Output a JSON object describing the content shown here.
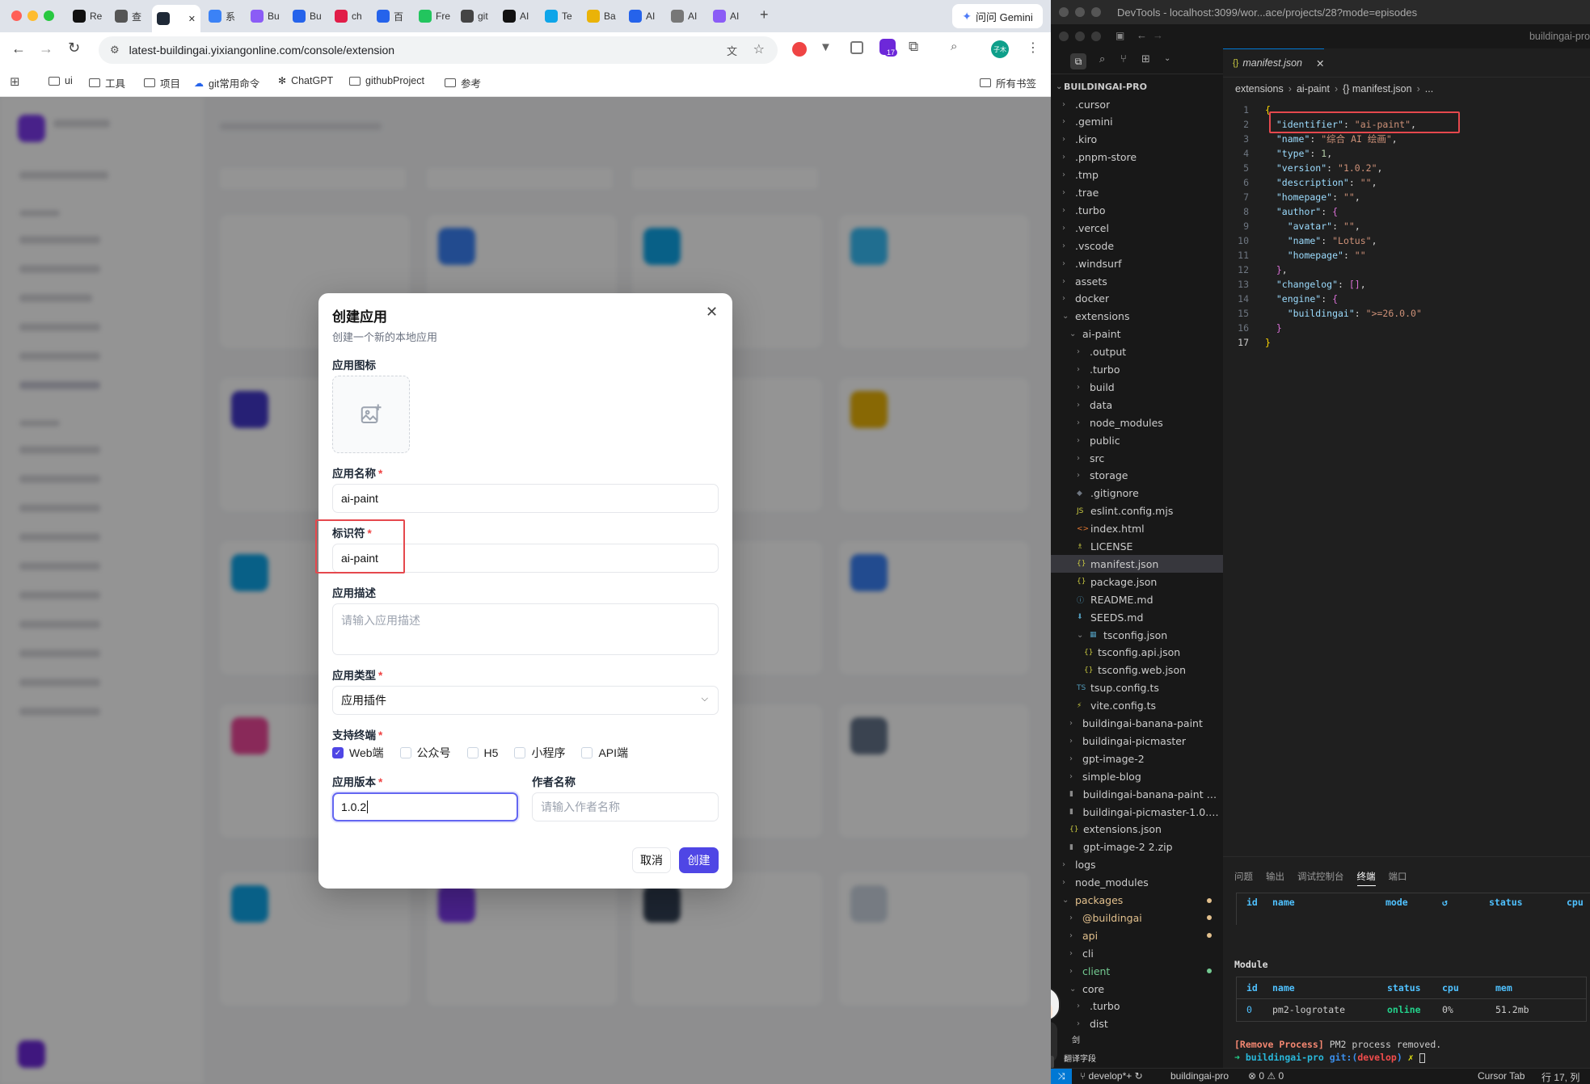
{
  "browser": {
    "tabs": [
      {
        "label": "Re",
        "color": "#111111"
      },
      {
        "label": "查",
        "color": "#555555"
      },
      {
        "label": "",
        "color": "#1f2937"
      },
      {
        "label": "系",
        "color": "#3b82f6"
      },
      {
        "label": "Bu",
        "color": "#8b5cf6"
      },
      {
        "label": "Bu",
        "color": "#2563eb"
      },
      {
        "label": "ch",
        "color": "#e11d48"
      },
      {
        "label": "百",
        "color": "#2563eb"
      },
      {
        "label": "Fre",
        "color": "#22c55e"
      },
      {
        "label": "git",
        "color": "#444444"
      },
      {
        "label": "AI",
        "color": "#111111"
      },
      {
        "label": "Te",
        "color": "#0ea5e9"
      },
      {
        "label": "Ba",
        "color": "#eab308"
      },
      {
        "label": "AI",
        "color": "#2563eb"
      },
      {
        "label": "AI",
        "color": "#777777"
      },
      {
        "label": "AI",
        "color": "#8b5cf6"
      }
    ],
    "new_tab": "+",
    "gemini_label": "问问 Gemini",
    "url": "latest-buildingai.yixiangonline.com/console/extension",
    "extension_badge": "17",
    "profile_label": "子木",
    "bookmarks": [
      "ui",
      "工具",
      "项目",
      "git常用命令",
      "ChatGPT",
      "githubProject",
      "参考"
    ],
    "all_bookmarks": "所有书签"
  },
  "modal": {
    "title": "创建应用",
    "subtitle": "创建一个新的本地应用",
    "icon_label": "应用图标",
    "name_label": "应用名称",
    "name_value": "ai-paint",
    "identifier_label": "标识符",
    "identifier_value": "ai-paint",
    "desc_label": "应用描述",
    "desc_placeholder": "请输入应用描述",
    "type_label": "应用类型",
    "type_value": "应用插件",
    "terminal_label": "支持终端",
    "terminals": [
      {
        "label": "Web端",
        "checked": true
      },
      {
        "label": "公众号",
        "checked": false
      },
      {
        "label": "H5",
        "checked": false
      },
      {
        "label": "小程序",
        "checked": false
      },
      {
        "label": "API端",
        "checked": false
      }
    ],
    "version_label": "应用版本",
    "version_value": "1.0.2",
    "author_label": "作者名称",
    "author_placeholder": "请输入作者名称",
    "cancel": "取消",
    "create": "创建",
    "required_mark": "*",
    "accent": "#4f46e5"
  },
  "devtools": {
    "title": "DevTools - localhost:3099/wor...ace/projects/28?mode=episodes",
    "window_title": "buildingai-pro",
    "tab_file": "manifest.json",
    "tab_icon": "{}",
    "breadcrumb": [
      "extensions",
      "ai-paint",
      "{} manifest.json",
      "..."
    ],
    "root": "BUILDINGAI-PRO",
    "tree": [
      {
        "name": ".cursor",
        "lvl": 0,
        "kind": "dir"
      },
      {
        "name": ".gemini",
        "lvl": 0,
        "kind": "dir"
      },
      {
        "name": ".kiro",
        "lvl": 0,
        "kind": "dir"
      },
      {
        "name": ".pnpm-store",
        "lvl": 0,
        "kind": "dir"
      },
      {
        "name": ".tmp",
        "lvl": 0,
        "kind": "dir"
      },
      {
        "name": ".trae",
        "lvl": 0,
        "kind": "dir"
      },
      {
        "name": ".turbo",
        "lvl": 0,
        "kind": "dir"
      },
      {
        "name": ".vercel",
        "lvl": 0,
        "kind": "dir"
      },
      {
        "name": ".vscode",
        "lvl": 0,
        "kind": "dir"
      },
      {
        "name": ".windsurf",
        "lvl": 0,
        "kind": "dir"
      },
      {
        "name": "assets",
        "lvl": 0,
        "kind": "dir"
      },
      {
        "name": "docker",
        "lvl": 0,
        "kind": "dir"
      },
      {
        "name": "extensions",
        "lvl": 0,
        "kind": "open"
      },
      {
        "name": "ai-paint",
        "lvl": 1,
        "kind": "open"
      },
      {
        "name": ".output",
        "lvl": 2,
        "kind": "dir"
      },
      {
        "name": ".turbo",
        "lvl": 2,
        "kind": "dir"
      },
      {
        "name": "build",
        "lvl": 2,
        "kind": "dir"
      },
      {
        "name": "data",
        "lvl": 2,
        "kind": "dir"
      },
      {
        "name": "node_modules",
        "lvl": 2,
        "kind": "dir"
      },
      {
        "name": "public",
        "lvl": 2,
        "kind": "dir"
      },
      {
        "name": "src",
        "lvl": 2,
        "kind": "dir"
      },
      {
        "name": "storage",
        "lvl": 2,
        "kind": "dir"
      },
      {
        "name": ".gitignore",
        "lvl": 2,
        "kind": "file",
        "icon": "◆",
        "icolor": "#6e7681"
      },
      {
        "name": "eslint.config.mjs",
        "lvl": 2,
        "kind": "file",
        "icon": "JS",
        "icolor": "#cbcb41"
      },
      {
        "name": "index.html",
        "lvl": 2,
        "kind": "file",
        "icon": "<>",
        "icolor": "#e37933"
      },
      {
        "name": "LICENSE",
        "lvl": 2,
        "kind": "file",
        "icon": "♗",
        "icolor": "#cbcb41"
      },
      {
        "name": "manifest.json",
        "lvl": 2,
        "kind": "file",
        "icon": "{}",
        "icolor": "#cbcb41",
        "selected": true
      },
      {
        "name": "package.json",
        "lvl": 2,
        "kind": "file",
        "icon": "{}",
        "icolor": "#cbcb41"
      },
      {
        "name": "README.md",
        "lvl": 2,
        "kind": "file",
        "icon": "ⓘ",
        "icolor": "#519aba"
      },
      {
        "name": "SEEDS.md",
        "lvl": 2,
        "kind": "file",
        "icon": "⬇",
        "icolor": "#519aba"
      },
      {
        "name": "tsconfig.json",
        "lvl": 2,
        "kind": "open",
        "icon": "▦",
        "icolor": "#519aba"
      },
      {
        "name": "tsconfig.api.json",
        "lvl": 3,
        "kind": "file",
        "icon": "{}",
        "icolor": "#cbcb41"
      },
      {
        "name": "tsconfig.web.json",
        "lvl": 3,
        "kind": "file",
        "icon": "{}",
        "icolor": "#cbcb41"
      },
      {
        "name": "tsup.config.ts",
        "lvl": 2,
        "kind": "file",
        "icon": "TS",
        "icolor": "#519aba"
      },
      {
        "name": "vite.config.ts",
        "lvl": 2,
        "kind": "file",
        "icon": "⚡",
        "icolor": "#cbcb41"
      },
      {
        "name": "buildingai-banana-paint",
        "lvl": 1,
        "kind": "dir"
      },
      {
        "name": "buildingai-picmaster",
        "lvl": 1,
        "kind": "dir"
      },
      {
        "name": "gpt-image-2",
        "lvl": 1,
        "kind": "dir"
      },
      {
        "name": "simple-blog",
        "lvl": 1,
        "kind": "dir"
      },
      {
        "name": "buildingai-banana-paint 2....",
        "lvl": 1,
        "kind": "file",
        "icon": "▮",
        "icolor": "#8a8a8a"
      },
      {
        "name": "buildingai-picmaster-1.0.5....",
        "lvl": 1,
        "kind": "file",
        "icon": "▮",
        "icolor": "#8a8a8a"
      },
      {
        "name": "extensions.json",
        "lvl": 1,
        "kind": "file",
        "icon": "{}",
        "icolor": "#cbcb41"
      },
      {
        "name": "gpt-image-2 2.zip",
        "lvl": 1,
        "kind": "file",
        "icon": "▮",
        "icolor": "#8a8a8a"
      },
      {
        "name": "logs",
        "lvl": 0,
        "kind": "dir"
      },
      {
        "name": "node_modules",
        "lvl": 0,
        "kind": "dir"
      },
      {
        "name": "packages",
        "lvl": 0,
        "kind": "open",
        "color": "#e2c08d",
        "dot": true
      },
      {
        "name": "@buildingai",
        "lvl": 1,
        "kind": "dir",
        "color": "#e2c08d",
        "dot": true
      },
      {
        "name": "api",
        "lvl": 1,
        "kind": "dir",
        "color": "#e2c08d",
        "dot": true
      },
      {
        "name": "cli",
        "lvl": 1,
        "kind": "dir"
      },
      {
        "name": "client",
        "lvl": 1,
        "kind": "dir",
        "color": "#73c991",
        "dot": true
      },
      {
        "name": "core",
        "lvl": 1,
        "kind": "open"
      },
      {
        "name": ".turbo",
        "lvl": 2,
        "kind": "dir"
      },
      {
        "name": "dist",
        "lvl": 2,
        "kind": "dir"
      }
    ],
    "code_lines": [
      [
        [
          "{",
          "b"
        ]
      ],
      [
        [
          "  \"identifier\"",
          "k"
        ],
        [
          ": ",
          "p"
        ],
        [
          "\"ai-paint\"",
          "s"
        ],
        [
          ",",
          "p"
        ]
      ],
      [
        [
          "  \"name\"",
          "k"
        ],
        [
          ": ",
          "p"
        ],
        [
          "\"综合 AI 绘画\"",
          "s"
        ],
        [
          ",",
          "p"
        ]
      ],
      [
        [
          "  \"type\"",
          "k"
        ],
        [
          ": ",
          "p"
        ],
        [
          "1",
          "n"
        ],
        [
          ",",
          "p"
        ]
      ],
      [
        [
          "  \"version\"",
          "k"
        ],
        [
          ": ",
          "p"
        ],
        [
          "\"1.0.2\"",
          "s"
        ],
        [
          ",",
          "p"
        ]
      ],
      [
        [
          "  \"description\"",
          "k"
        ],
        [
          ": ",
          "p"
        ],
        [
          "\"\"",
          "s"
        ],
        [
          ",",
          "p"
        ]
      ],
      [
        [
          "  \"homepage\"",
          "k"
        ],
        [
          ": ",
          "p"
        ],
        [
          "\"\"",
          "s"
        ],
        [
          ",",
          "p"
        ]
      ],
      [
        [
          "  \"author\"",
          "k"
        ],
        [
          ": ",
          "p"
        ],
        [
          "{",
          "b2"
        ]
      ],
      [
        [
          "    \"avatar\"",
          "k"
        ],
        [
          ": ",
          "p"
        ],
        [
          "\"\"",
          "s"
        ],
        [
          ",",
          "p"
        ]
      ],
      [
        [
          "    \"name\"",
          "k"
        ],
        [
          ": ",
          "p"
        ],
        [
          "\"Lotus\"",
          "s"
        ],
        [
          ",",
          "p"
        ]
      ],
      [
        [
          "    \"homepage\"",
          "k"
        ],
        [
          ": ",
          "p"
        ],
        [
          "\"\"",
          "s"
        ]
      ],
      [
        [
          "  }",
          "b2"
        ],
        [
          ",",
          "p"
        ]
      ],
      [
        [
          "  \"changelog\"",
          "k"
        ],
        [
          ": ",
          "p"
        ],
        [
          "[]",
          "b2"
        ],
        [
          ",",
          "p"
        ]
      ],
      [
        [
          "  \"engine\"",
          "k"
        ],
        [
          ": ",
          "p"
        ],
        [
          "{",
          "b2"
        ]
      ],
      [
        [
          "    \"buildingai\"",
          "k"
        ],
        [
          ": ",
          "p"
        ],
        [
          "\">=26.0.0\"",
          "s"
        ]
      ],
      [
        [
          "  }",
          "b2"
        ]
      ],
      [
        [
          "}",
          "b"
        ]
      ]
    ],
    "panel_tabs": [
      "问题",
      "输出",
      "调试控制台",
      "终端",
      "端口"
    ],
    "table1_headers": [
      "id",
      "name",
      "mode",
      "↺",
      "status",
      "cpu"
    ],
    "module_title": "Module",
    "table2_headers": [
      "id",
      "name",
      "status",
      "cpu",
      "mem"
    ],
    "table2_row": [
      "0",
      "pm2-logrotate",
      "online",
      "0%",
      "51.2mb"
    ],
    "remove_line_tag": "[Remove Process]",
    "remove_line_text": " PM2 process removed.",
    "prompt_arrow": "➜",
    "prompt_dir": "buildingai-pro",
    "prompt_git": "git:(",
    "prompt_branch": "develop",
    "prompt_close": ")",
    "prompt_x": "✗",
    "status": {
      "branch": "develop*+",
      "folder": "buildingai-pro",
      "errors": "⊗ 0 ⚠ 0",
      "cursor_tab": "Cursor Tab",
      "position": "行 17, 列"
    },
    "mascot_text1": "剑",
    "mascot_text2": "翻译字段"
  }
}
